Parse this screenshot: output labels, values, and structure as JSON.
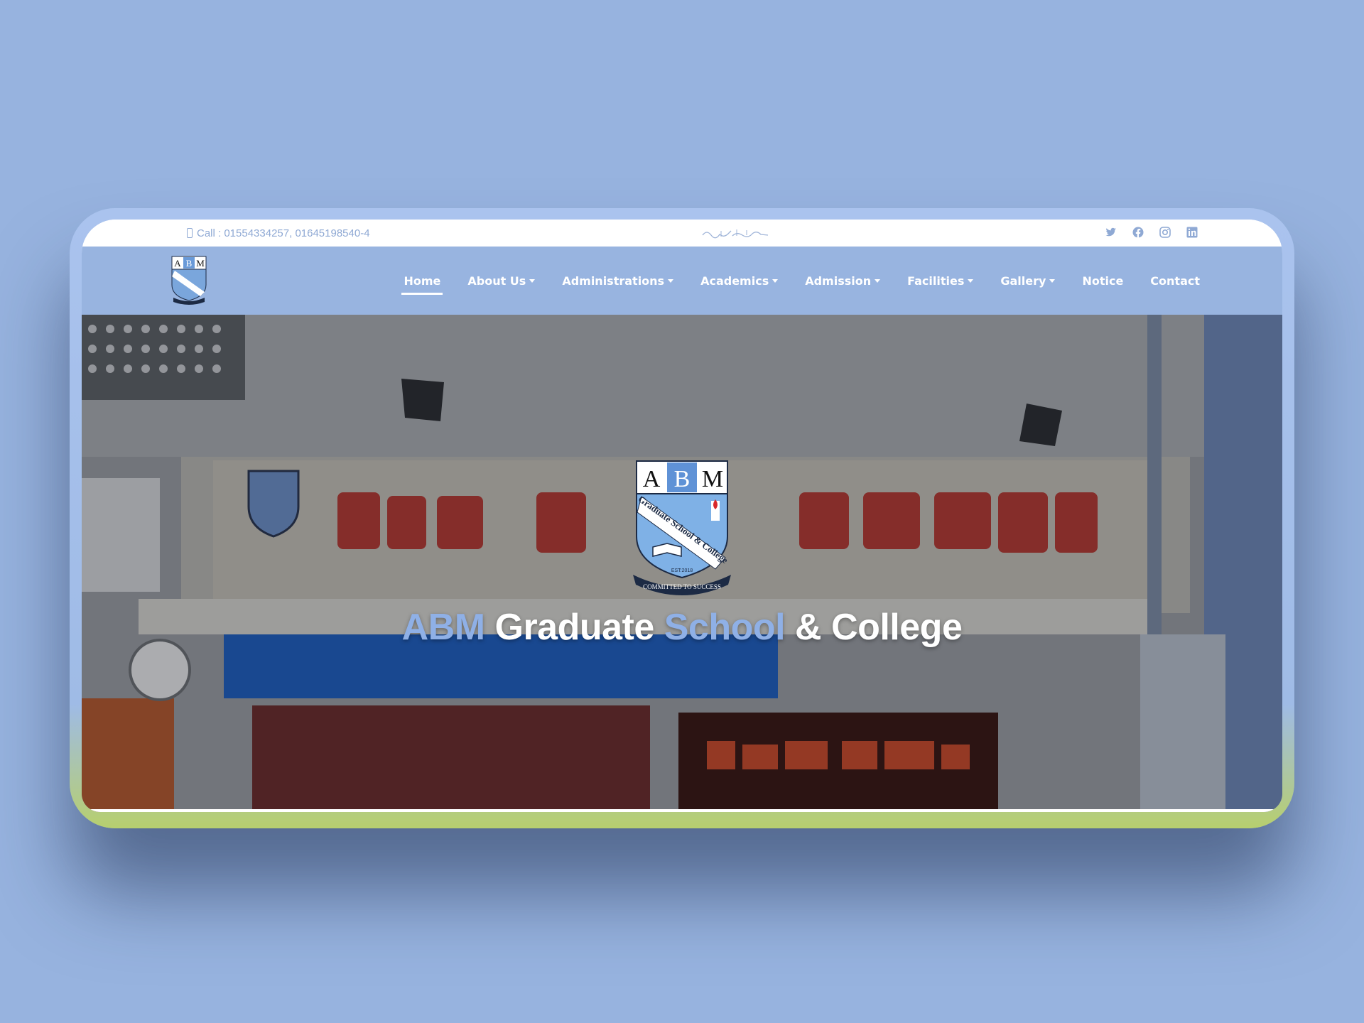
{
  "topbar": {
    "call_text": "Call : 01554334257, 01645198540-4",
    "socials": [
      "twitter-icon",
      "facebook-icon",
      "instagram-icon",
      "linkedin-icon"
    ]
  },
  "nav": {
    "items": [
      {
        "label": "Home",
        "dropdown": false,
        "active": true
      },
      {
        "label": "About Us",
        "dropdown": true
      },
      {
        "label": "Administrations",
        "dropdown": true
      },
      {
        "label": "Academics",
        "dropdown": true
      },
      {
        "label": "Admission",
        "dropdown": true
      },
      {
        "label": "Facilities",
        "dropdown": true
      },
      {
        "label": "Gallery",
        "dropdown": true
      },
      {
        "label": "Notice",
        "dropdown": false
      },
      {
        "label": "Contact",
        "dropdown": false
      }
    ]
  },
  "hero": {
    "title_word1": "ABM",
    "title_word2": "Graduate",
    "title_word3": "School",
    "title_word4": "& College"
  },
  "logo": {
    "letters": [
      "A",
      "B",
      "M"
    ],
    "band_text": "Graduate School & College",
    "est": "EST:2018",
    "motto": "COMMITTED TO SUCCESS"
  },
  "colors": {
    "background": "#97b3df",
    "nav_bg": "#98b4e0",
    "accent": "#8fb0e6",
    "text_muted": "#8fa9d4"
  }
}
